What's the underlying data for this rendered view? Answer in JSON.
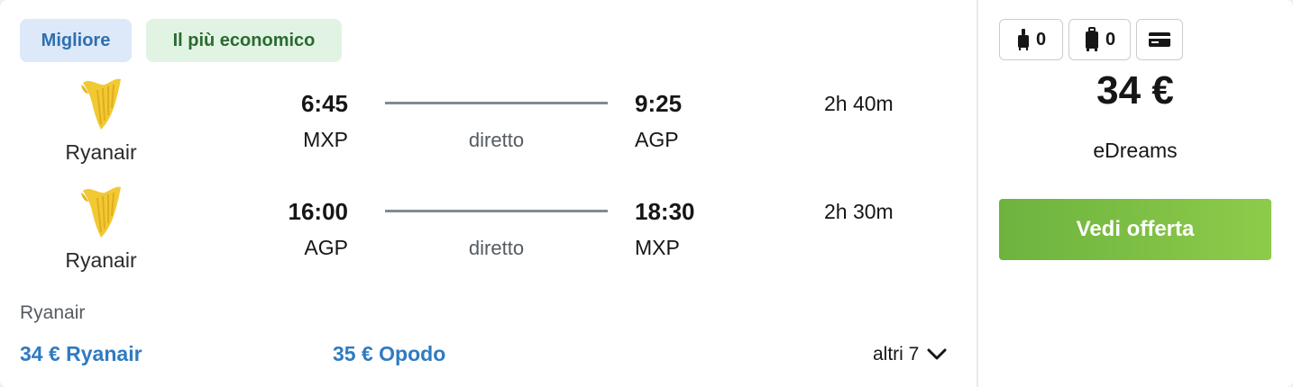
{
  "badges": {
    "best": "Migliore",
    "cheapest": "Il più economico"
  },
  "flights": [
    {
      "airline": "Ryanair",
      "dep_time": "6:45",
      "dep_code": "MXP",
      "stops": "diretto",
      "arr_time": "9:25",
      "arr_code": "AGP",
      "duration": "2h 40m"
    },
    {
      "airline": "Ryanair",
      "dep_time": "16:00",
      "dep_code": "AGP",
      "stops": "diretto",
      "arr_time": "18:30",
      "arr_code": "MXP",
      "duration": "2h 30m"
    }
  ],
  "operated_by": "Ryanair",
  "deals": [
    {
      "label": "34 € Ryanair"
    },
    {
      "label": "35 € Opodo"
    }
  ],
  "more_label": "altri 7",
  "fare_icons": {
    "cabin_bag_count": "0",
    "checked_bag_count": "0"
  },
  "price": "34 €",
  "provider": "eDreams",
  "cta_label": "Vedi offerta",
  "colors": {
    "accent": "#2e7bc2",
    "cta": "#7abf44",
    "logo": "#f1c933",
    "best_badge_bg": "#dde9f8",
    "cheap_badge_bg": "#e1f4e4"
  }
}
